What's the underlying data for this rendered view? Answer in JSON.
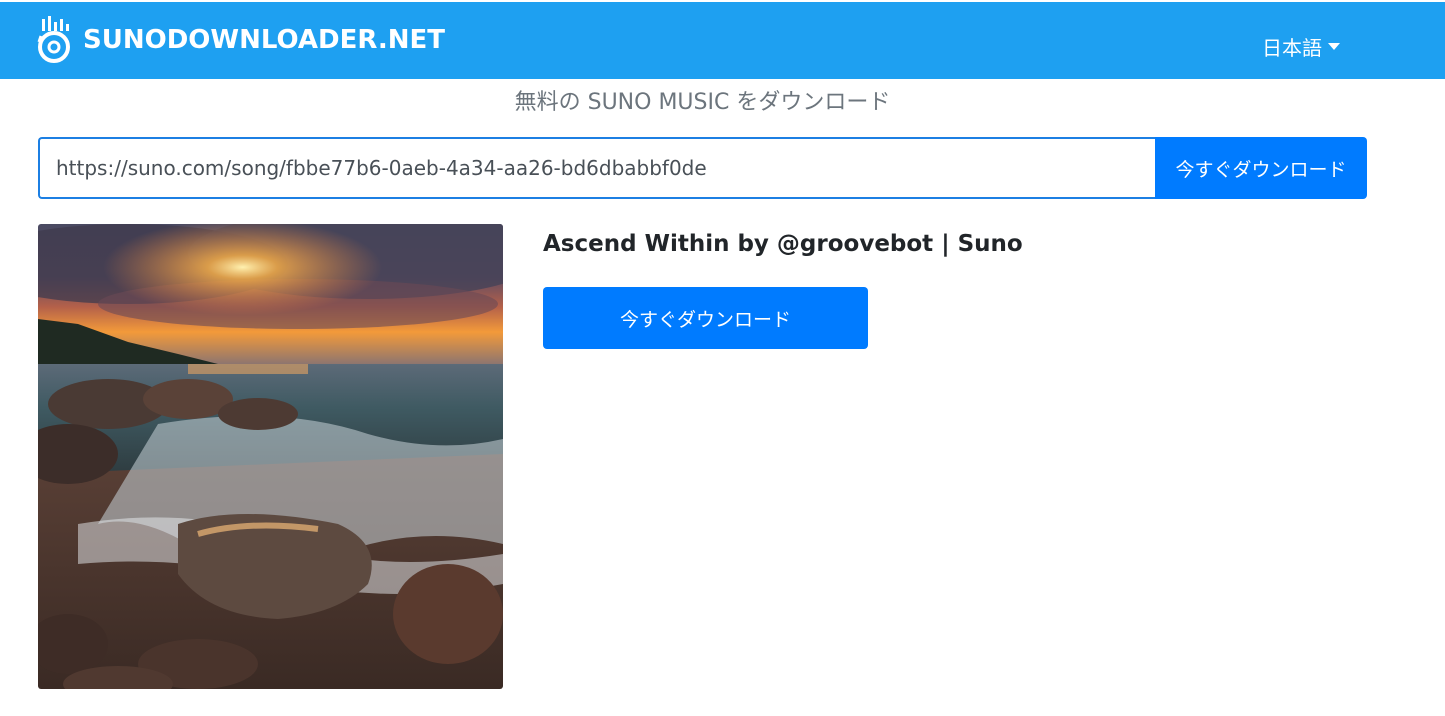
{
  "header": {
    "brand": "SUNODOWNLOADER.NET",
    "logo_icon": "soundwave-disc-icon",
    "language": "日本語",
    "colors": {
      "navbar": "#1ea0f1"
    }
  },
  "hero": {
    "subtitle": "無料の SUNO MUSIC をダウンロード"
  },
  "search": {
    "value": "https://suno.com/song/fbbe77b6-0aeb-4a34-aa26-bd6dbabbf0de",
    "button_label": "今すぐダウンロード"
  },
  "result": {
    "title": "Ascend Within by @groovebot | Suno",
    "download_label": "今すぐダウンロード",
    "accent": "#007bff"
  }
}
